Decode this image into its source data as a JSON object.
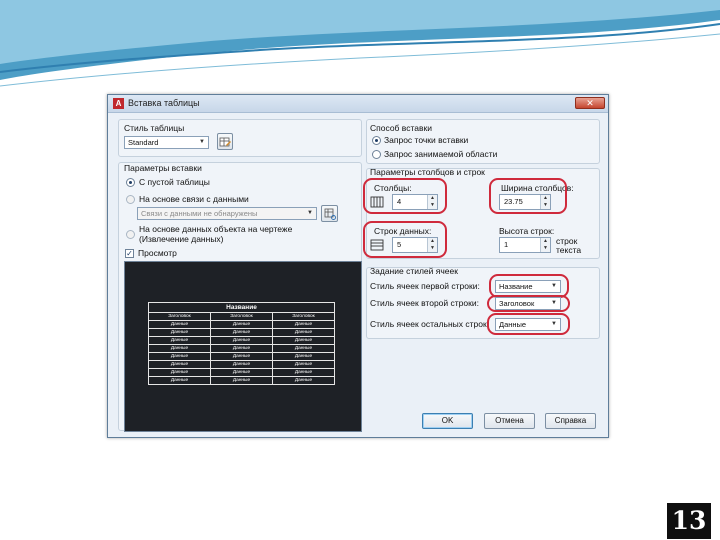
{
  "slide": {
    "page_number": "13"
  },
  "dialog": {
    "title": "Вставка таблицы",
    "close_label": "✕",
    "table_style": {
      "group_label": "Стиль таблицы",
      "value": "Standard"
    },
    "insert_options": {
      "group_label": "Параметры вставки",
      "empty_table": "С пустой таблицы",
      "from_data_link": "На основе связи с данными",
      "data_link_placeholder": "Связи с данными не обнаружены",
      "from_object_data": "На основе данных объекта на чертеже (Извлечение данных)",
      "preview_label": "Просмотр"
    },
    "insert_method": {
      "group_label": "Способ вставки",
      "insertion_point": "Запрос точки вставки",
      "window": "Запрос занимаемой области"
    },
    "columns_rows": {
      "group_label": "Параметры столбцов и строк",
      "columns_label": "Столбцы:",
      "columns_value": "4",
      "column_width_label": "Ширина столбцов:",
      "column_width_value": "23.75",
      "data_rows_label": "Строк данных:",
      "data_rows_value": "5",
      "row_height_label": "Высота строк:",
      "row_height_value": "1",
      "row_height_unit": "строк текста"
    },
    "cell_styles": {
      "group_label": "Задание стилей ячеек",
      "first_row_label": "Стиль ячеек первой строки:",
      "first_row_value": "Название",
      "second_row_label": "Стиль ячеек второй строки:",
      "second_row_value": "Заголовок",
      "other_rows_label": "Стиль ячеек остальных строк:",
      "other_rows_value": "Данные"
    },
    "buttons": {
      "ok": "OK",
      "cancel": "Отмена",
      "help": "Справка"
    },
    "preview_table": {
      "title": "Название",
      "headers": [
        "Заголовок",
        "Заголовок",
        "Заголовок"
      ],
      "rows": [
        [
          "Данные",
          "Данные",
          "Данные"
        ],
        [
          "Данные",
          "Данные",
          "Данные"
        ],
        [
          "Данные",
          "Данные",
          "Данные"
        ],
        [
          "Данные",
          "Данные",
          "Данные"
        ],
        [
          "Данные",
          "Данные",
          "Данные"
        ],
        [
          "Данные",
          "Данные",
          "Данные"
        ],
        [
          "Данные",
          "Данные",
          "Данные"
        ],
        [
          "Данные",
          "Данные",
          "Данные"
        ]
      ]
    }
  },
  "colors": {
    "highlight": "#cf2a3c",
    "preview_bg": "#1e2126",
    "slide_accent": "#2f7fb0"
  }
}
